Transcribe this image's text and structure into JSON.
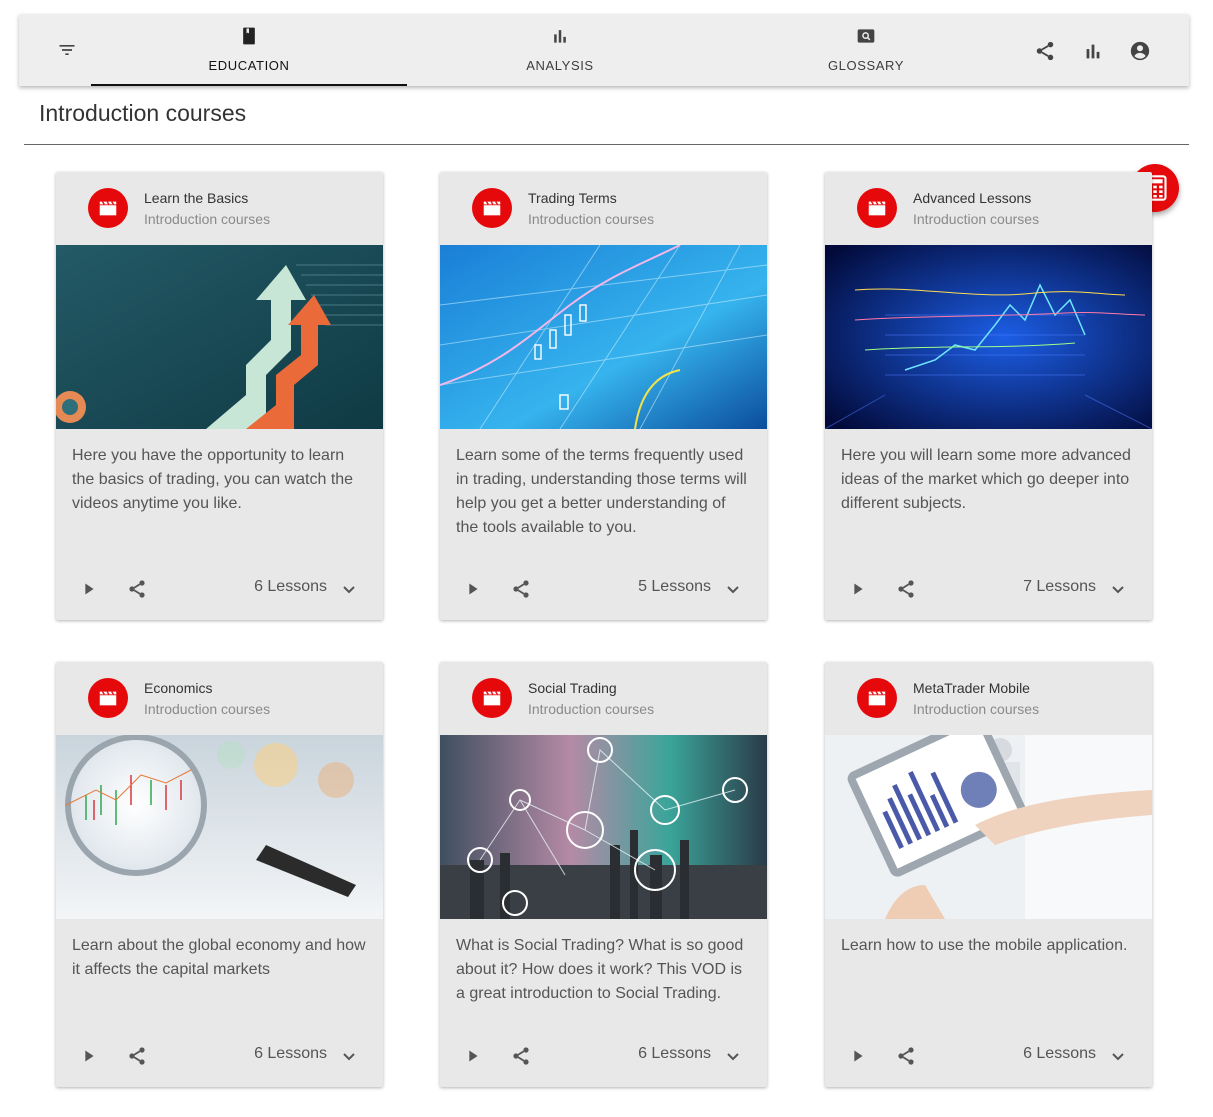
{
  "header": {
    "icons": [
      "filter-icon",
      "share-icon",
      "bar-chart-icon",
      "account-icon"
    ],
    "tabs": [
      {
        "label": "EDUCATION",
        "icon": "book-icon",
        "active": true
      },
      {
        "label": "ANALYSIS",
        "icon": "bar-chart-icon",
        "active": false
      },
      {
        "label": "GLOSSARY",
        "icon": "search-icon",
        "active": false
      }
    ]
  },
  "section": {
    "title": "Introduction courses"
  },
  "colors": {
    "accent": "#e6090b",
    "topbar": "#eeeeee",
    "card": "#e8e8e8"
  },
  "fab": {
    "icon": "calculator-icon"
  },
  "cards": [
    {
      "title": "Learn the Basics",
      "subtitle": "Introduction courses",
      "description": "Here you have the opportunity to learn the basics of trading, you can watch the videos anytime you like.",
      "lessons": "6 Lessons"
    },
    {
      "title": "Trading Terms",
      "subtitle": "Introduction courses",
      "description": "Learn some of the terms frequently used in trading, understanding those terms will help you get a better understanding of the tools available to you.",
      "lessons": "5 Lessons"
    },
    {
      "title": "Advanced Lessons",
      "subtitle": "Introduction courses",
      "description": "Here you will learn some more advanced ideas of the market which go deeper into different subjects.",
      "lessons": "7 Lessons"
    },
    {
      "title": "Economics",
      "subtitle": "Introduction courses",
      "description": "Learn about the global economy and how it affects the capital markets",
      "lessons": "6 Lessons"
    },
    {
      "title": "Social Trading",
      "subtitle": "Introduction courses",
      "description": "What is Social Trading? What is so good about it? How does it work? This VOD is a great introduction to Social Trading.",
      "lessons": "6 Lessons"
    },
    {
      "title": "MetaTrader Mobile",
      "subtitle": "Introduction courses",
      "description": "Learn how to use the mobile application.",
      "lessons": "6 Lessons"
    }
  ]
}
